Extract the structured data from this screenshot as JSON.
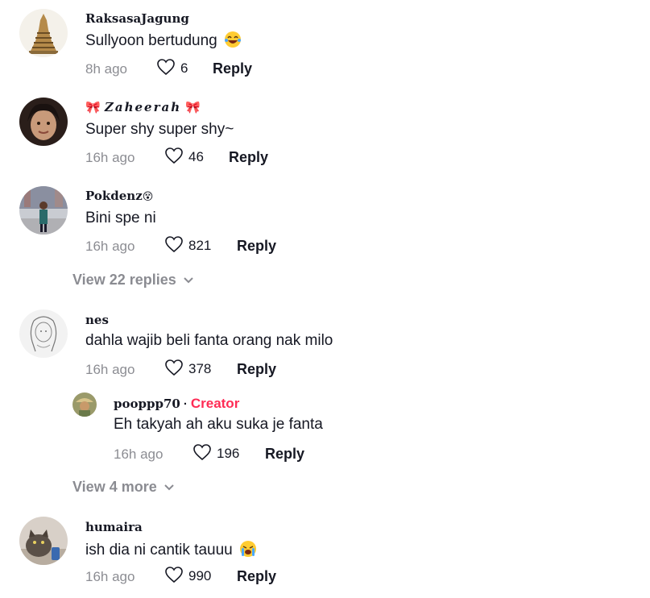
{
  "comments": [
    {
      "username": "RaksasaJagung",
      "text": "Sullyoon bertudung",
      "emoji": "laughing-tears-emoji",
      "time": "8h ago",
      "likes": "6",
      "reply": "Reply"
    },
    {
      "username_prefix": "🎀",
      "username": "𝒁𝒂𝒉𝒆𝒆𝒓𝒂𝒉",
      "username_suffix": "🎀",
      "text": "Super shy super shy~",
      "time": "16h ago",
      "likes": "46",
      "reply": "Reply"
    },
    {
      "username": "Pokdenz",
      "username_suffix": "😵",
      "text": "Bini spe ni",
      "time": "16h ago",
      "likes": "821",
      "reply": "Reply",
      "view_replies": "View 22 replies"
    },
    {
      "username": "nes",
      "text": "dahla wajib beli fanta orang nak milo",
      "time": "16h ago",
      "likes": "378",
      "reply": "Reply",
      "replies": [
        {
          "username": "pooppp70",
          "separator": "·",
          "badge": "Creator",
          "text": "Eh takyah ah aku suka je fanta",
          "time": "16h ago",
          "likes": "196",
          "reply": "Reply"
        }
      ],
      "view_more": "View 4 more"
    },
    {
      "username": "humaira",
      "text": "ish dia ni cantik tauuu",
      "emoji": "crying-face-emoji",
      "time": "16h ago",
      "likes": "990",
      "reply": "Reply"
    }
  ],
  "colors": {
    "creator": "#fe2c55",
    "text": "#161823",
    "muted": "rgba(22,24,35,0.5)"
  }
}
